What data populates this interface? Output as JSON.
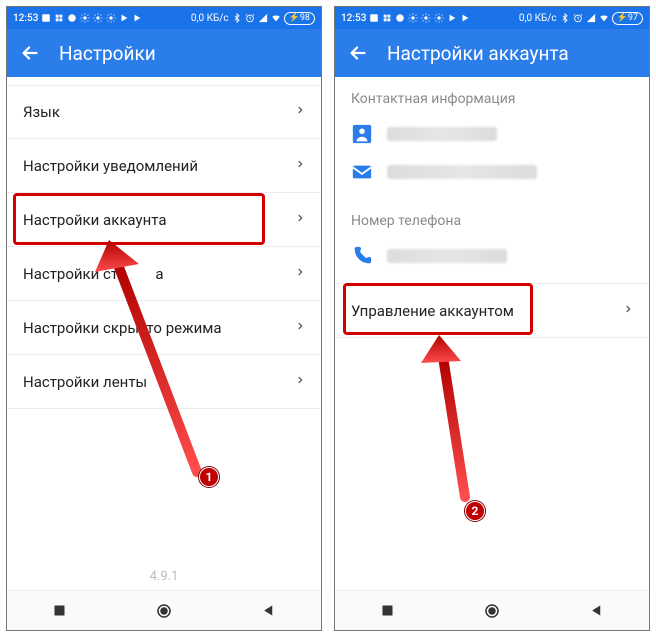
{
  "phones": {
    "left": {
      "status": {
        "time": "12:53",
        "data_rate": "0,0 КБ/с",
        "battery": "98"
      },
      "header": {
        "title": "Настройки"
      },
      "rows": [
        "Язык",
        "Настройки уведомлений",
        "Настройки аккаунта",
        "Настройки ст          а",
        "Настройки скры  то режима",
        "Настройки ленты"
      ],
      "version": "4.9.1",
      "badge": "1"
    },
    "right": {
      "status": {
        "time": "12:53",
        "data_rate": "0,0 КБ/с",
        "battery": "97"
      },
      "header": {
        "title": "Настройки аккаунта"
      },
      "section_contact": "Контактная информация",
      "section_phone": "Номер телефона",
      "manage_row": "Управление аккаунтом",
      "badge": "2"
    }
  }
}
